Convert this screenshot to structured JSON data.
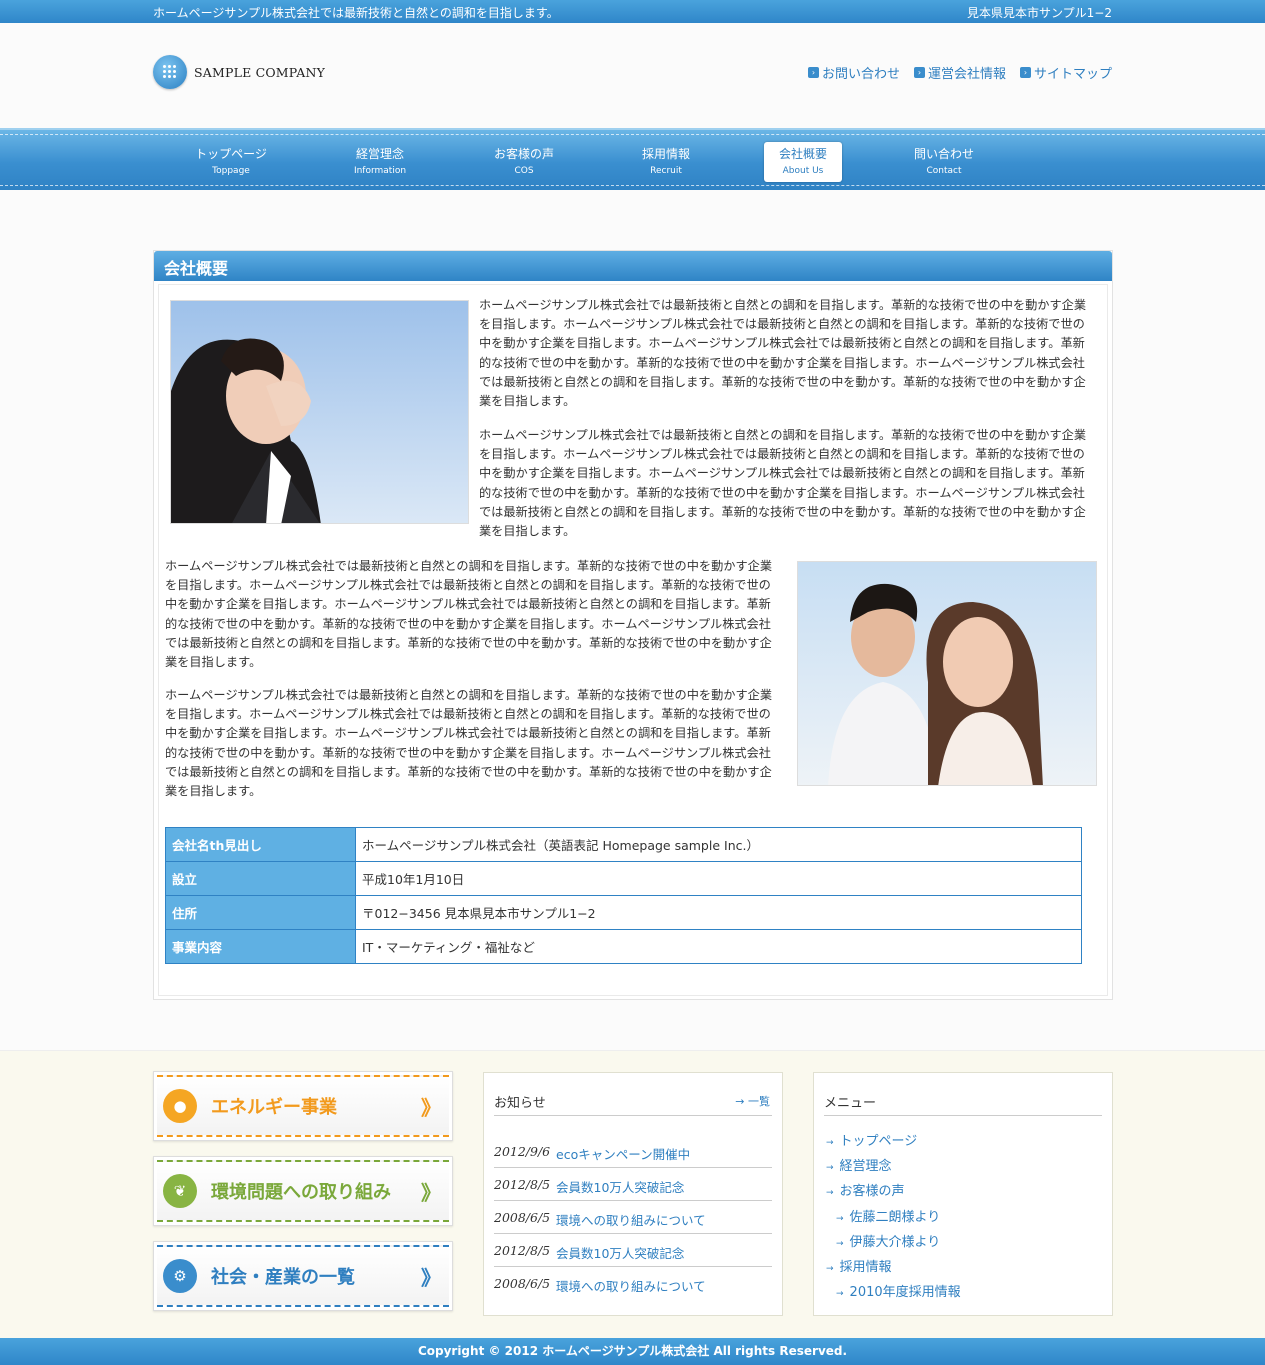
{
  "topbar": {
    "tagline": "ホームページサンプル株式会社では最新技術と自然との調和を目指します。",
    "address": "見本県見本市サンプル1−2"
  },
  "logo": {
    "text": "SAMPLE COMPANY"
  },
  "header_links": [
    {
      "label": "お問い合わせ",
      "icon": "arrow-square-icon"
    },
    {
      "label": "運営会社情報",
      "icon": "arrow-square-icon"
    },
    {
      "label": "サイトマップ",
      "icon": "arrow-square-icon"
    }
  ],
  "nav": [
    {
      "jp": "トップページ",
      "en": "Toppage",
      "active": false
    },
    {
      "jp": "経営理念",
      "en": "Information",
      "active": false
    },
    {
      "jp": "お客様の声",
      "en": "COS",
      "active": false
    },
    {
      "jp": "採用情報",
      "en": "Recruit",
      "active": false
    },
    {
      "jp": "会社概要",
      "en": "About Us",
      "active": true
    },
    {
      "jp": "問い合わせ",
      "en": "Contact",
      "active": false
    }
  ],
  "section": {
    "title": "会社概要",
    "para1a": "ホームページサンプル株式会社では最新技術と自然との調和を目指します。革新的な技術で世の中を動かす企業を目指します。ホームページサンプル株式会社では最新技術と自然との調和を目指します。革新的な技術で世の中を動かす企業を目指します。ホームページサンプル株式会社では最新技術と自然との調和を目指します。革新的な技術で世の中を動かす。革新的な技術で世の中を動かす企業を目指します。ホームページサンプル株式会社では最新技術と自然との調和を目指します。革新的な技術で世の中を動かす。革新的な技術で世の中を動かす企業を目指します。",
    "para1b": "ホームページサンプル株式会社では最新技術と自然との調和を目指します。革新的な技術で世の中を動かす企業を目指します。ホームページサンプル株式会社では最新技術と自然との調和を目指します。革新的な技術で世の中を動かす企業を目指します。ホームページサンプル株式会社では最新技術と自然との調和を目指します。革新的な技術で世の中を動かす。革新的な技術で世の中を動かす企業を目指します。ホームページサンプル株式会社では最新技術と自然との調和を目指します。革新的な技術で世の中を動かす。革新的な技術で世の中を動かす企業を目指します。",
    "para2a": "ホームページサンプル株式会社では最新技術と自然との調和を目指します。革新的な技術で世の中を動かす企業を目指します。ホームページサンプル株式会社では最新技術と自然との調和を目指します。革新的な技術で世の中を動かす企業を目指します。ホームページサンプル株式会社では最新技術と自然との調和を目指します。革新的な技術で世の中を動かす。革新的な技術で世の中を動かす企業を目指します。ホームページサンプル株式会社では最新技術と自然との調和を目指します。革新的な技術で世の中を動かす。革新的な技術で世の中を動かす企業を目指します。",
    "para2b": "ホームページサンプル株式会社では最新技術と自然との調和を目指します。革新的な技術で世の中を動かす企業を目指します。ホームページサンプル株式会社では最新技術と自然との調和を目指します。革新的な技術で世の中を動かす企業を目指します。ホームページサンプル株式会社では最新技術と自然との調和を目指します。革新的な技術で世の中を動かす。革新的な技術で世の中を動かす企業を目指します。ホームページサンプル株式会社では最新技術と自然との調和を目指します。革新的な技術で世の中を動かす。革新的な技術で世の中を動かす企業を目指します。"
  },
  "info_table": [
    {
      "th": "会社名th見出し",
      "td": "ホームページサンプル株式会社（英語表記 Homepage sample Inc.）"
    },
    {
      "th": "設立",
      "td": "平成10年1月10日"
    },
    {
      "th": "住所",
      "td": "〒012−3456 見本県見本市サンプル1−2"
    },
    {
      "th": "事業内容",
      "td": "IT・マーケティング・福祉など"
    }
  ],
  "banners": [
    {
      "label": "エネルギー事業",
      "color": "#f29a1d",
      "icon": "lightbulb-icon",
      "arrow": "》"
    },
    {
      "label": "環境問題への取り組み",
      "color": "#7aa83a",
      "icon": "leaf-icon",
      "arrow": "》"
    },
    {
      "label": "社会・産業の一覧",
      "color": "#2f7fc0",
      "icon": "gear-icon",
      "arrow": "》"
    }
  ],
  "news": {
    "title": "お知らせ",
    "more": "一覧",
    "items": [
      {
        "date": "2012/9/6",
        "text": "ecoキャンペーン開催中"
      },
      {
        "date": "2012/8/5",
        "text": "会員数10万人突破記念"
      },
      {
        "date": "2008/6/5",
        "text": "環境への取り組みについて"
      },
      {
        "date": "2012/8/5",
        "text": "会員数10万人突破記念"
      },
      {
        "date": "2008/6/5",
        "text": "環境への取り組みについて"
      }
    ]
  },
  "menu": {
    "title": "メニュー",
    "items": [
      {
        "label": "トップページ",
        "level": 0
      },
      {
        "label": "経営理念",
        "level": 0
      },
      {
        "label": "お客様の声",
        "level": 0
      },
      {
        "label": "佐藤二朗様より",
        "level": 1
      },
      {
        "label": "伊藤大介様より",
        "level": 1
      },
      {
        "label": "採用情報",
        "level": 0
      },
      {
        "label": "2010年度採用情報",
        "level": 1
      }
    ]
  },
  "copyright": "Copyright © 2012 ホームページサンプル株式会社 All rights Reserved."
}
